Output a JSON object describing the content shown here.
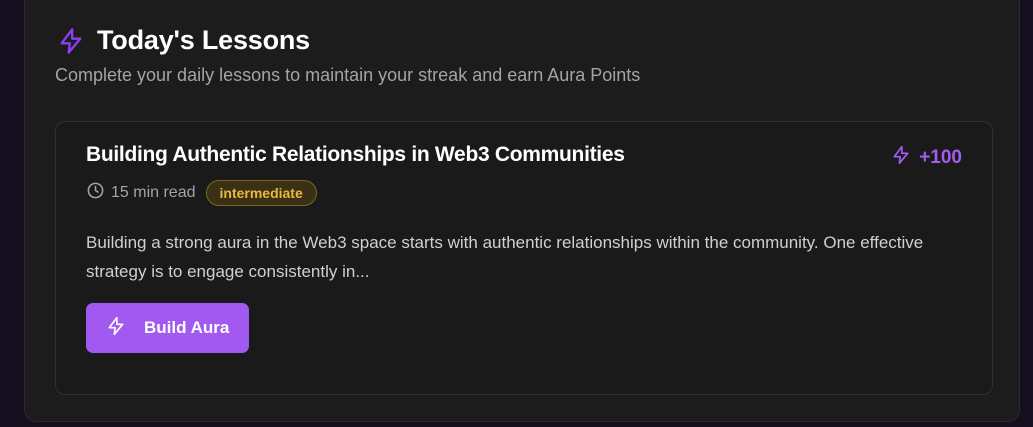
{
  "section": {
    "title": "Today's Lessons",
    "subtitle": "Complete your daily lessons to maintain your streak and earn Aura Points",
    "icon": "lightning-icon"
  },
  "lesson": {
    "title": "Building Authentic Relationships in Web3 Communities",
    "points": "+100",
    "read_time": "15 min read",
    "level": "intermediate",
    "excerpt": "Building a strong aura in the Web3 space starts with authentic relationships within the community. One effective strategy is to engage consistently in...",
    "button_label": "Build Aura"
  },
  "colors": {
    "accent": "#a259f0",
    "badge_text": "#e8bb3a",
    "background": "#1c1c1d"
  }
}
